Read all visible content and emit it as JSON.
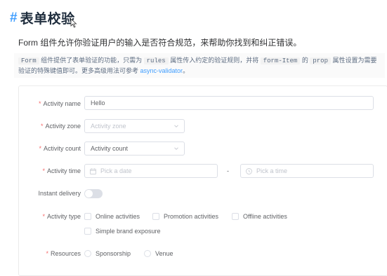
{
  "header": {
    "hash": "#",
    "title": "表单校验"
  },
  "subtitle": "Form 组件允许你验证用户的输入是否符合规范，来帮助你找到和纠正错误。",
  "description": {
    "code1": "Form",
    "text1": "组件提供了表单验证的功能，只需为",
    "code2": "rules",
    "text2": "属性传入约定的验证规则，并将",
    "code3": "form-Item",
    "text3": "的",
    "code4": "prop",
    "text4": "属性设置为需要验证的特殊键值即可。更多高级用法可参考",
    "link": "async-validator",
    "end": "。"
  },
  "form": {
    "activity_name": {
      "label": "Activity name",
      "value": "Hello"
    },
    "activity_zone": {
      "label": "Activity zone",
      "placeholder": "Activity zone"
    },
    "activity_count": {
      "label": "Activity count",
      "value": "Activity count"
    },
    "activity_time": {
      "label": "Activity time",
      "date_placeholder": "Pick a date",
      "separator": "-",
      "time_placeholder": "Pick a time"
    },
    "instant_delivery": {
      "label": "Instant delivery",
      "on": false
    },
    "activity_type": {
      "label": "Activity type",
      "options": [
        "Online activities",
        "Promotion activities",
        "Offline activities",
        "Simple brand exposure"
      ]
    },
    "resources": {
      "label": "Resources",
      "options": [
        "Sponsorship",
        "Venue"
      ]
    },
    "required_mark": "*"
  }
}
